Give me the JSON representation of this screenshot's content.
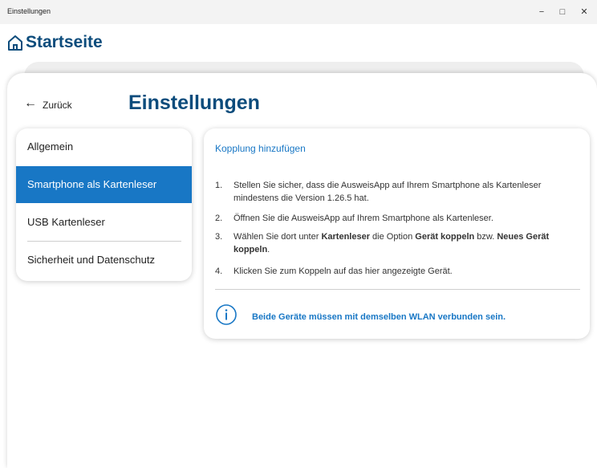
{
  "window": {
    "title": "Einstellungen",
    "minimize_label": "−",
    "maximize_label": "□",
    "close_label": "✕"
  },
  "home": {
    "title": "Startseite",
    "icon": "home-icon"
  },
  "nav": {
    "back_arrow": "←",
    "back_label": "Zurück"
  },
  "page": {
    "title": "Einstellungen"
  },
  "sidebar": {
    "items": [
      {
        "label": "Allgemein",
        "active": false
      },
      {
        "label": "Smartphone als Kartenleser",
        "active": true
      },
      {
        "label": "USB Kartenleser",
        "active": false
      },
      {
        "label": "Sicherheit und Datenschutz",
        "active": false
      }
    ]
  },
  "content": {
    "title": "Kopplung hinzufügen",
    "steps": [
      {
        "num": "1.",
        "text": "Stellen Sie sicher, dass die AusweisApp auf Ihrem Smartphone als Kartenleser mindestens die Version 1.26.5 hat."
      },
      {
        "num": "2.",
        "text": "Öffnen Sie die AusweisApp auf Ihrem Smartphone als Kartenleser."
      },
      {
        "num": "3.",
        "text_parts": [
          "Wählen Sie dort unter ",
          "Kartenleser",
          " die Option ",
          "Gerät koppeln",
          " bzw. ",
          "Neues Gerät koppeln",
          "."
        ]
      },
      {
        "num": "4.",
        "text": "Klicken Sie zum Koppeln auf das hier angezeigte Gerät."
      }
    ],
    "hint": "Beide Geräte müssen mit demselben WLAN verbunden sein.",
    "hint_icon": "info-icon"
  },
  "colors": {
    "brand": "#0c4c7c",
    "accent": "#1877c5"
  }
}
